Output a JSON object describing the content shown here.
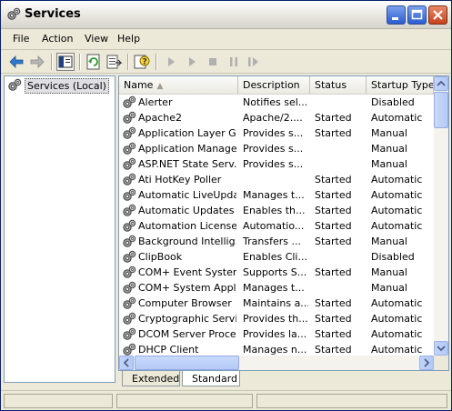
{
  "window": {
    "title": "Services",
    "icon": "gears-icon"
  },
  "menu": [
    "File",
    "Action",
    "View",
    "Help"
  ],
  "tree": {
    "root_label": "Services (Local)"
  },
  "columns": [
    "Name",
    "Description",
    "Status",
    "Startup Type"
  ],
  "rows": [
    {
      "name": "Alerter",
      "description": "Notifies sel...",
      "status": "",
      "startup": "Disabled"
    },
    {
      "name": "Apache2",
      "description": "Apache/2....",
      "status": "Started",
      "startup": "Automatic"
    },
    {
      "name": "Application Layer G...",
      "description": "Provides s...",
      "status": "Started",
      "startup": "Manual"
    },
    {
      "name": "Application Manage...",
      "description": "Provides s...",
      "status": "",
      "startup": "Manual"
    },
    {
      "name": "ASP.NET State Serv...",
      "description": "Provides s...",
      "status": "",
      "startup": "Manual"
    },
    {
      "name": "Ati HotKey Poller",
      "description": "",
      "status": "Started",
      "startup": "Automatic"
    },
    {
      "name": "Automatic LiveUpda...",
      "description": "Manages t...",
      "status": "Started",
      "startup": "Automatic"
    },
    {
      "name": "Automatic Updates",
      "description": "Enables th...",
      "status": "Started",
      "startup": "Automatic"
    },
    {
      "name": "Automation License ...",
      "description": "Automatio...",
      "status": "Started",
      "startup": "Automatic"
    },
    {
      "name": "Background Intellig...",
      "description": "Transfers ...",
      "status": "Started",
      "startup": "Manual"
    },
    {
      "name": "ClipBook",
      "description": "Enables Cli...",
      "status": "",
      "startup": "Disabled"
    },
    {
      "name": "COM+ Event System",
      "description": "Supports S...",
      "status": "Started",
      "startup": "Manual"
    },
    {
      "name": "COM+ System Appli...",
      "description": "Manages t...",
      "status": "",
      "startup": "Manual"
    },
    {
      "name": "Computer Browser",
      "description": "Maintains a...",
      "status": "Started",
      "startup": "Automatic"
    },
    {
      "name": "Cryptographic Servi...",
      "description": "Provides th...",
      "status": "Started",
      "startup": "Automatic"
    },
    {
      "name": "DCOM Server Proce...",
      "description": "Provides la...",
      "status": "Started",
      "startup": "Automatic"
    },
    {
      "name": "DHCP Client",
      "description": "Manages n...",
      "status": "Started",
      "startup": "Automatic"
    }
  ],
  "tabs": [
    "Extended",
    "Standard"
  ],
  "active_tab": "Standard",
  "colors": {
    "title_bg": "#eceae4",
    "window_face": "#ece9d8",
    "selection": "#e0dfe3",
    "scroll_blue": "#b4c9f6"
  }
}
